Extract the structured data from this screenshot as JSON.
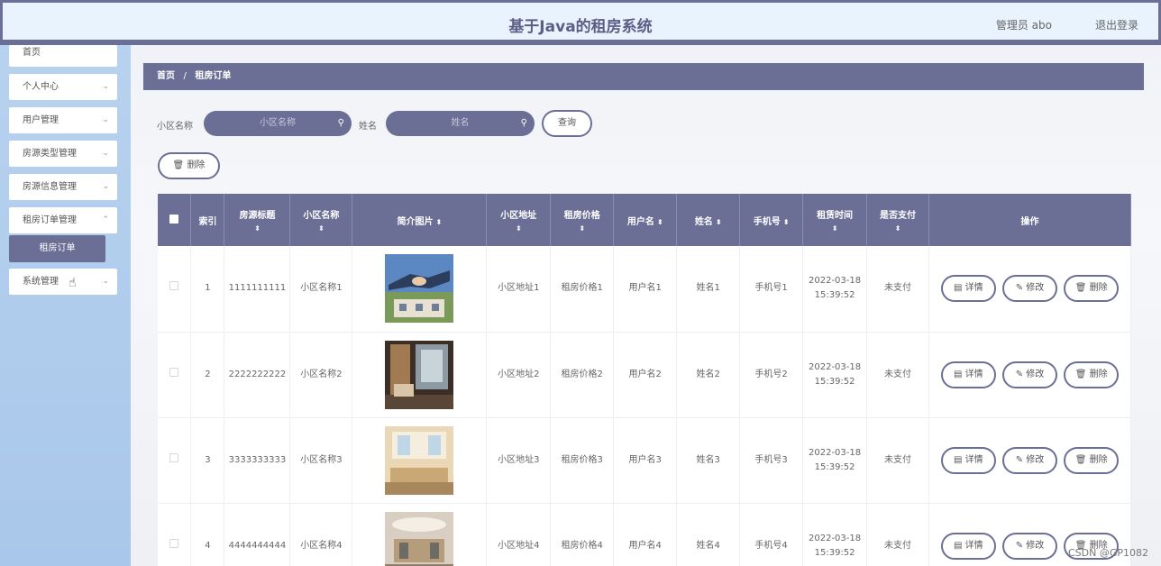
{
  "header": {
    "title": "基于Java的租房系统",
    "admin_label": "管理员 abo",
    "logout_label": "退出登录"
  },
  "sidebar": {
    "items": [
      {
        "label": "首页"
      },
      {
        "label": "个人中心"
      },
      {
        "label": "用户管理"
      },
      {
        "label": "房源类型管理"
      },
      {
        "label": "房源信息管理"
      },
      {
        "label": "租房订单管理"
      },
      {
        "label": "系统管理"
      }
    ],
    "active_sub": "租房订单"
  },
  "breadcrumb": {
    "home": "首页",
    "separator": "/",
    "current": "租房订单"
  },
  "search": {
    "community_label": "小区名称",
    "community_placeholder": "小区名称",
    "name_label": "姓名",
    "name_placeholder": "姓名",
    "query_label": "查询"
  },
  "toolbar": {
    "delete_label": "删除"
  },
  "table": {
    "columns": [
      "索引",
      "房源标题",
      "小区名称",
      "简介图片",
      "小区地址",
      "租房价格",
      "用户名",
      "姓名",
      "手机号",
      "租赁时间",
      "是否支付",
      "操作"
    ],
    "rows": [
      {
        "index": "1",
        "title": "1111111111",
        "community": "小区名称1",
        "address": "小区地址1",
        "price": "租房价格1",
        "username": "用户名1",
        "name": "姓名1",
        "phone": "手机号1",
        "time": "2022-03-18 15:39:52",
        "paid": "未支付"
      },
      {
        "index": "2",
        "title": "2222222222",
        "community": "小区名称2",
        "address": "小区地址2",
        "price": "租房价格2",
        "username": "用户名2",
        "name": "姓名2",
        "phone": "手机号2",
        "time": "2022-03-18 15:39:52",
        "paid": "未支付"
      },
      {
        "index": "3",
        "title": "3333333333",
        "community": "小区名称3",
        "address": "小区地址3",
        "price": "租房价格3",
        "username": "用户名3",
        "name": "姓名3",
        "phone": "手机号3",
        "time": "2022-03-18 15:39:52",
        "paid": "未支付"
      },
      {
        "index": "4",
        "title": "4444444444",
        "community": "小区名称4",
        "address": "小区地址4",
        "price": "租房价格4",
        "username": "用户名4",
        "name": "姓名4",
        "phone": "手机号4",
        "time": "2022-03-18 15:39:52",
        "paid": "未支付"
      }
    ],
    "actions": {
      "detail": "详情",
      "edit": "修改",
      "delete": "删除"
    }
  },
  "watermark": "CSDN @GP1082",
  "colors": {
    "primary": "#6c6f95",
    "header_bg": "#e8f3fd",
    "sidebar_bg": "#b7d2ef"
  }
}
